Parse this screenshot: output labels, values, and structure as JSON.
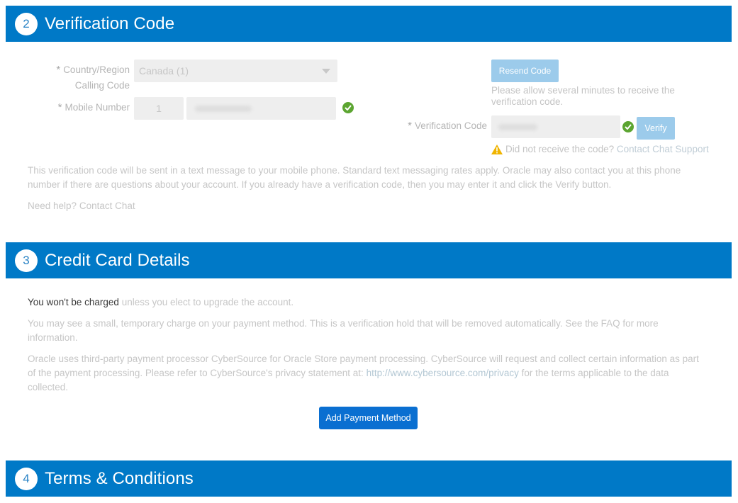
{
  "sections": [
    {
      "number": "2",
      "title": "Verification Code"
    },
    {
      "number": "3",
      "title": "Credit Card Details"
    },
    {
      "number": "4",
      "title": "Terms & Conditions"
    }
  ],
  "verification": {
    "required_mark": "*",
    "country_label_line1": "Country/Region",
    "country_label_line2": "Calling Code",
    "country_value": "Canada (1)",
    "mobile_label": "Mobile Number",
    "mobile_prefix": "1",
    "mobile_number_value": "",
    "resend_button": "Resend Code",
    "resend_note": "Please allow several minutes to receive the verification code.",
    "code_label": "Verification Code",
    "code_value": "",
    "verify_button": "Verify",
    "warning_text": "Did not receive the code?",
    "warning_link": "Contact Chat Support",
    "info_text": "This verification code will be sent in a text message to your mobile phone. Standard text messaging rates apply. Oracle may also contact you at this phone number if there are questions about your account. If you already have a verification code, then you may enter it and click the Verify button.",
    "help_text": "Need help?",
    "help_link": "Contact Chat"
  },
  "credit_card": {
    "charge_bold": "You won't be charged",
    "charge_rest": " unless you elect to upgrade the account.",
    "hold_text": "You may see a small, temporary charge on your payment method. This is a verification hold that will be removed automatically. See the FAQ for more information.",
    "processor_text_before": "Oracle uses third-party payment processor CyberSource for Oracle Store payment processing. CyberSource will request and collect certain information as part of the payment processing. Please refer to CyberSource's privacy statement at: ",
    "processor_link": "http://www.cybersource.com/privacy",
    "processor_text_after": " for the terms applicable to the data collected.",
    "add_payment_button": "Add Payment Method"
  },
  "colors": {
    "header_bg": "#0079c7",
    "primary_button": "#0a6fd1",
    "disabled_button": "#9ccbeb",
    "success": "#5ca531",
    "warning": "#f0b400"
  }
}
